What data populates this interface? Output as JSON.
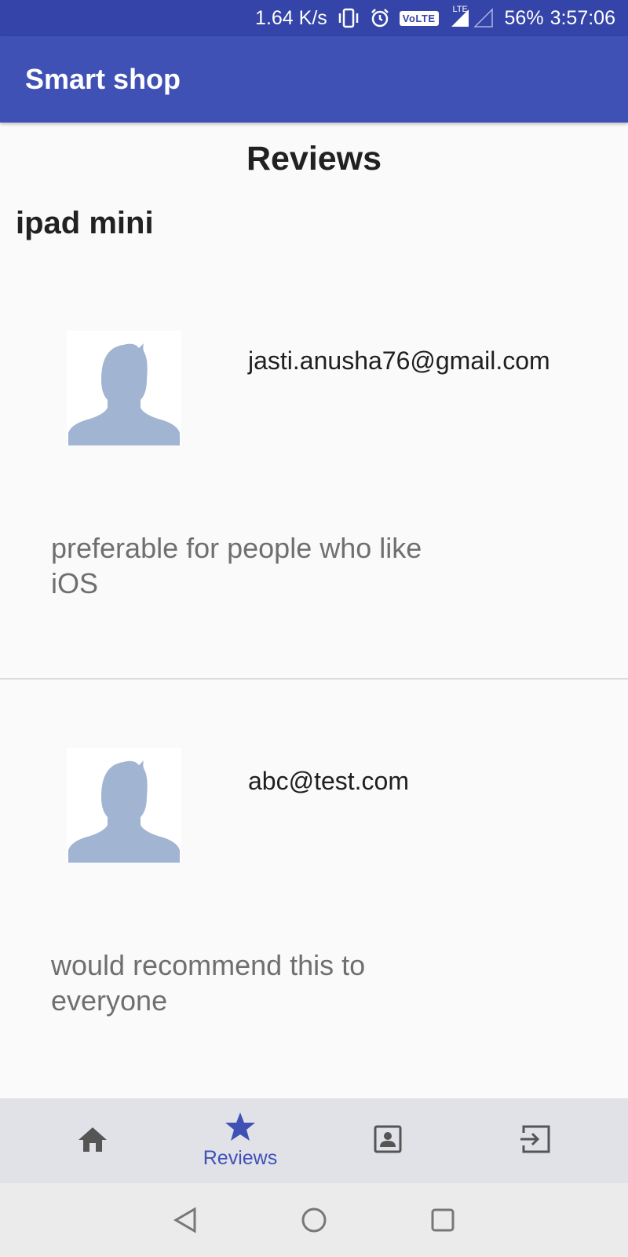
{
  "status_bar": {
    "network_speed": "1.64 K/s",
    "volte_label": "VoLTE",
    "lte_label": "LTE",
    "battery": "56%",
    "time": "3:57:06",
    "icons": [
      "vibrate-icon",
      "alarm-icon",
      "signal-icon"
    ]
  },
  "app_bar": {
    "title": "Smart shop"
  },
  "page": {
    "title": "Reviews",
    "product_name": "ipad mini"
  },
  "reviews": [
    {
      "email": "jasti.anusha76@gmail.com",
      "text": "preferable for people who like iOS",
      "avatar_icon": "person-placeholder-icon"
    },
    {
      "email": "abc@test.com",
      "text": "would recommend this to everyone",
      "avatar_icon": "person-placeholder-icon"
    }
  ],
  "bottom_nav": {
    "items": [
      {
        "icon": "home-icon",
        "label": ""
      },
      {
        "icon": "star-icon",
        "label": "Reviews",
        "active": true
      },
      {
        "icon": "account-box-icon",
        "label": ""
      },
      {
        "icon": "exit-icon",
        "label": ""
      }
    ]
  },
  "system_nav": {
    "icons": [
      "back-icon",
      "home-circle-icon",
      "recents-icon"
    ]
  },
  "colors": {
    "status_bar": "#3444a8",
    "app_bar": "#3f51b5",
    "accent": "#3f51b5",
    "avatar": "#a1b4d2",
    "bottom_nav_bg": "#e1e1e8"
  }
}
